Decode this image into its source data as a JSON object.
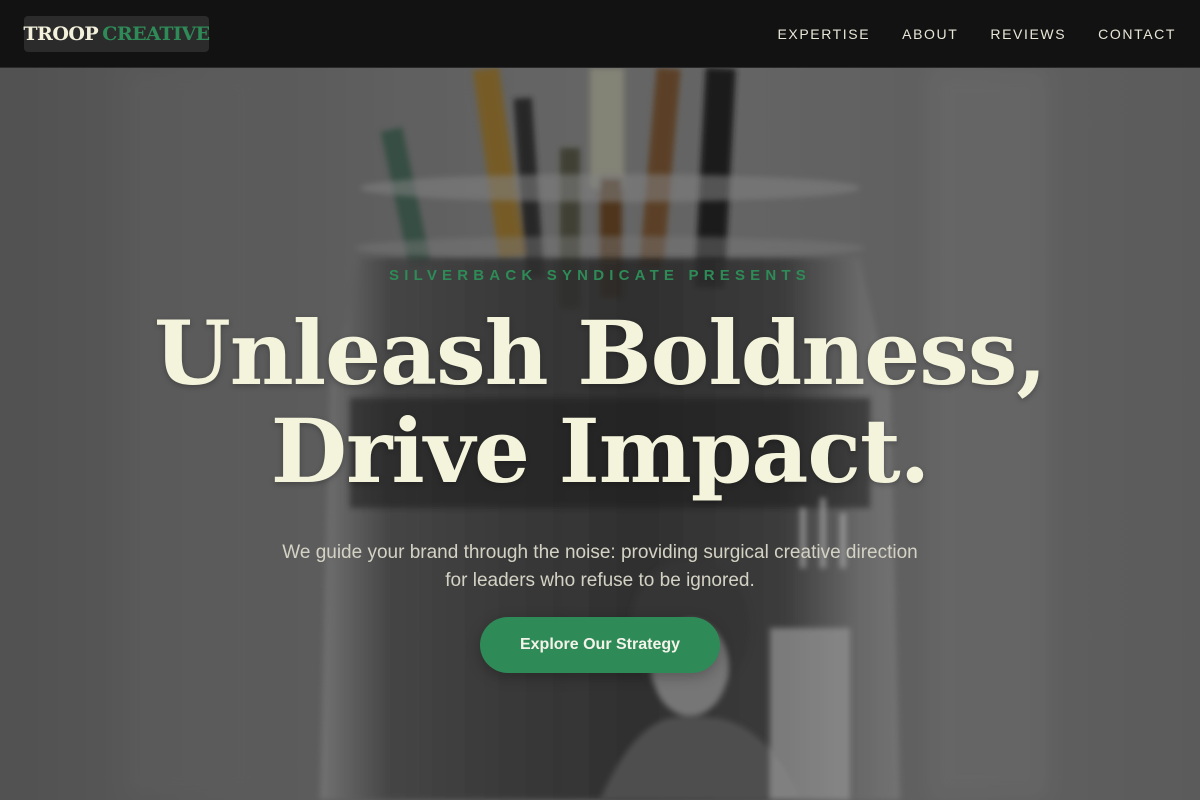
{
  "brand": {
    "name_primary": "TROOP",
    "name_secondary": "CREATIVE"
  },
  "nav": {
    "items": [
      {
        "label": "EXPERTISE"
      },
      {
        "label": "ABOUT"
      },
      {
        "label": "REVIEWS"
      },
      {
        "label": "CONTACT"
      }
    ]
  },
  "hero": {
    "eyebrow": "SILVERBACK SYNDICATE PRESENTS",
    "headline_line1": "Unleash Boldness,",
    "headline_line2": "Drive Impact.",
    "subtext": "We guide your brand through the noise: providing surgical creative direction for leaders who refuse to be ignored.",
    "cta_label": "Explore Our Strategy",
    "background_image": "jar-of-paintbrushes-photo"
  },
  "colors": {
    "accent_green": "#2e8b57",
    "headline_cream": "#f4f3dc",
    "navbar_bg": "#121212"
  }
}
